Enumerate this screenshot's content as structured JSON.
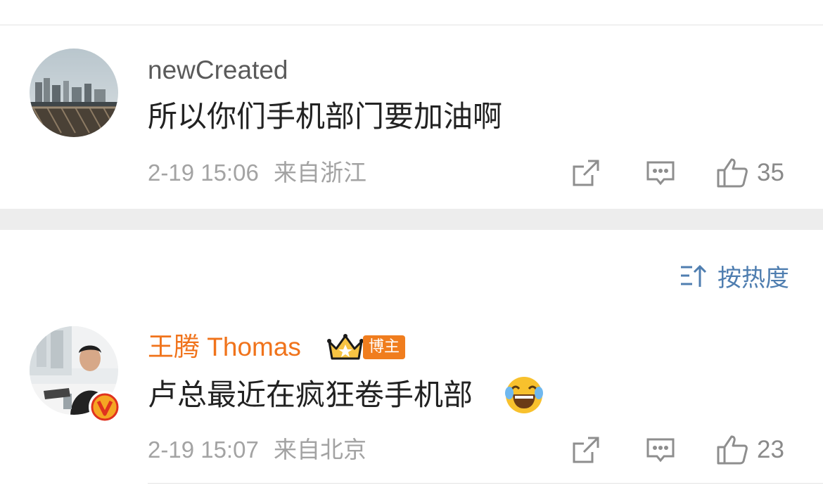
{
  "comments": [
    {
      "username": "newCreated",
      "text": "所以你们手机部门要加油啊",
      "date": "2-19 15:06",
      "location": "来自浙江",
      "likes": "35"
    },
    {
      "username": "王腾 Thomas",
      "badge": "博主",
      "text": "卢总最近在疯狂卷手机部",
      "emoji": "laughing-tears-emoji",
      "date": "2-19 15:07",
      "location": "来自北京",
      "likes": "23"
    }
  ],
  "sort": {
    "label": "按热度"
  },
  "colors": {
    "username_highlight": "#f0731b",
    "link_blue": "#4f7eb0",
    "meta_gray": "#a3a3a3",
    "section_gap": "#ededed"
  }
}
